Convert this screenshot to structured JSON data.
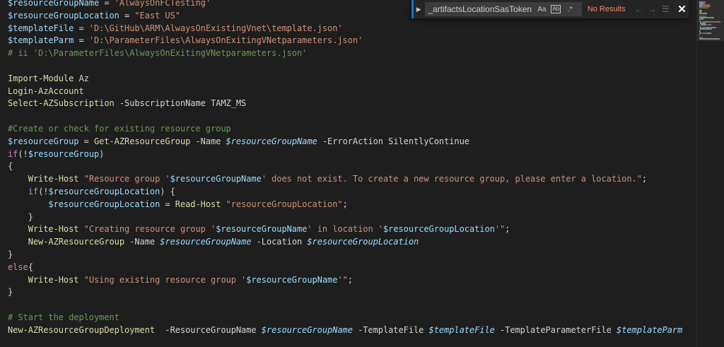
{
  "editor": {
    "lines": [
      [
        [
          "tok-var",
          "$resourceGroupName"
        ],
        [
          "tok-op",
          " = "
        ],
        [
          "tok-str",
          "'AlwaysOnFCTesting'"
        ]
      ],
      [
        [
          "tok-var",
          "$resourceGroupLocation"
        ],
        [
          "tok-op",
          " = "
        ],
        [
          "tok-str",
          "\"East US\""
        ]
      ],
      [
        [
          "tok-var",
          "$templateFile"
        ],
        [
          "tok-op",
          " = "
        ],
        [
          "tok-str",
          "'D:\\GitHub\\ARM\\AlwaysOnExistingVnet\\template.json'"
        ]
      ],
      [
        [
          "tok-var",
          "$templateParm"
        ],
        [
          "tok-op",
          " = "
        ],
        [
          "tok-str",
          "'D:\\ParameterFiles\\AlwaysOnExitingVNetparameters.json'"
        ]
      ],
      [
        [
          "tok-cmt",
          "# ii 'D:\\ParameterFiles\\AlwaysOnExitingVNetparameters.json'"
        ]
      ],
      [],
      [
        [
          "tok-cmd",
          "Import-Module"
        ],
        [
          "tok-plain",
          " Az"
        ]
      ],
      [
        [
          "tok-cmd",
          "Login-AzAccount"
        ]
      ],
      [
        [
          "tok-cmd",
          "Select-AZSubscription"
        ],
        [
          "tok-param",
          " -SubscriptionName"
        ],
        [
          "tok-plain",
          " TAMZ_MS"
        ]
      ],
      [],
      [
        [
          "tok-cmt",
          "#Create or check for existing resource group"
        ]
      ],
      [
        [
          "tok-var",
          "$resourceGroup"
        ],
        [
          "tok-op",
          " = "
        ],
        [
          "tok-cmd",
          "Get-AZResourceGroup"
        ],
        [
          "tok-param",
          " -Name "
        ],
        [
          "tok-vari",
          "$resourceGroupName"
        ],
        [
          "tok-param",
          " -ErrorAction"
        ],
        [
          "tok-plain",
          " SilentlyContinue"
        ]
      ],
      [
        [
          "tok-kw",
          "if"
        ],
        [
          "tok-op",
          "(!"
        ],
        [
          "tok-var",
          "$resourceGroup"
        ],
        [
          "tok-op",
          ")"
        ]
      ],
      [
        [
          "tok-op",
          "{"
        ]
      ],
      [
        [
          "tok-plain",
          "    "
        ],
        [
          "tok-cmd",
          "Write-Host"
        ],
        [
          "tok-plain",
          " "
        ],
        [
          "tok-str",
          "\"Resource group '"
        ],
        [
          "tok-var",
          "$resourceGroupName"
        ],
        [
          "tok-str",
          "' does not exist. To create a new resource group, please enter a location.\""
        ],
        [
          "tok-op",
          ";"
        ]
      ],
      [
        [
          "tok-plain",
          "    "
        ],
        [
          "tok-kw",
          "if"
        ],
        [
          "tok-op",
          "(!"
        ],
        [
          "tok-var",
          "$resourceGroupLocation"
        ],
        [
          "tok-op",
          ") {"
        ]
      ],
      [
        [
          "tok-plain",
          "        "
        ],
        [
          "tok-var",
          "$resourceGroupLocation"
        ],
        [
          "tok-op",
          " = "
        ],
        [
          "tok-cmd",
          "Read-Host"
        ],
        [
          "tok-plain",
          " "
        ],
        [
          "tok-str",
          "\"resourceGroupLocation\""
        ],
        [
          "tok-op",
          ";"
        ]
      ],
      [
        [
          "tok-plain",
          "    "
        ],
        [
          "tok-op",
          "}"
        ]
      ],
      [
        [
          "tok-plain",
          "    "
        ],
        [
          "tok-cmd",
          "Write-Host"
        ],
        [
          "tok-plain",
          " "
        ],
        [
          "tok-str",
          "\"Creating resource group '"
        ],
        [
          "tok-var",
          "$resourceGroupName"
        ],
        [
          "tok-str",
          "' in location '"
        ],
        [
          "tok-var",
          "$resourceGroupLocation"
        ],
        [
          "tok-str",
          "'\""
        ],
        [
          "tok-op",
          ";"
        ]
      ],
      [
        [
          "tok-plain",
          "    "
        ],
        [
          "tok-cmd",
          "New-AZResourceGroup"
        ],
        [
          "tok-param",
          " -Name "
        ],
        [
          "tok-vari",
          "$resourceGroupName"
        ],
        [
          "tok-param",
          " -Location "
        ],
        [
          "tok-vari",
          "$resourceGroupLocation"
        ]
      ],
      [
        [
          "tok-op",
          "}"
        ]
      ],
      [
        [
          "tok-kw",
          "else"
        ],
        [
          "tok-op",
          "{"
        ]
      ],
      [
        [
          "tok-plain",
          "    "
        ],
        [
          "tok-cmd",
          "Write-Host"
        ],
        [
          "tok-plain",
          " "
        ],
        [
          "tok-str",
          "\"Using existing resource group '"
        ],
        [
          "tok-var",
          "$resourceGroupName"
        ],
        [
          "tok-str",
          "'\""
        ],
        [
          "tok-op",
          ";"
        ]
      ],
      [
        [
          "tok-op",
          "}"
        ]
      ],
      [],
      [
        [
          "tok-cmt",
          "# Start the deployment"
        ]
      ],
      [
        [
          "tok-cmd",
          "New-AZResourceGroupDeployment"
        ],
        [
          "tok-param",
          "  -ResourceGroupName "
        ],
        [
          "tok-vari",
          "$resourceGroupName"
        ],
        [
          "tok-param",
          " -TemplateFile "
        ],
        [
          "tok-vari",
          "$templateFile"
        ],
        [
          "tok-param",
          " -TemplateParameterFile "
        ],
        [
          "tok-vari",
          "$templateParm"
        ]
      ]
    ]
  },
  "find": {
    "query": "_artifactsLocationSasToken",
    "match_case_label": "Aa",
    "whole_word_label": "Ab",
    "regex_label": ".*",
    "result": "No Results",
    "prev_glyph": "←",
    "next_glyph": "→",
    "selection_glyph": "☰",
    "close_glyph": "✕",
    "toggle_glyph": "▶"
  },
  "colors": {
    "background": "#1e1e1e",
    "variable": "#9cdcfe",
    "string": "#ce9178",
    "comment": "#6a9955",
    "command": "#dcdcaa",
    "keyword": "#c586c0",
    "no_results": "#f48771"
  }
}
